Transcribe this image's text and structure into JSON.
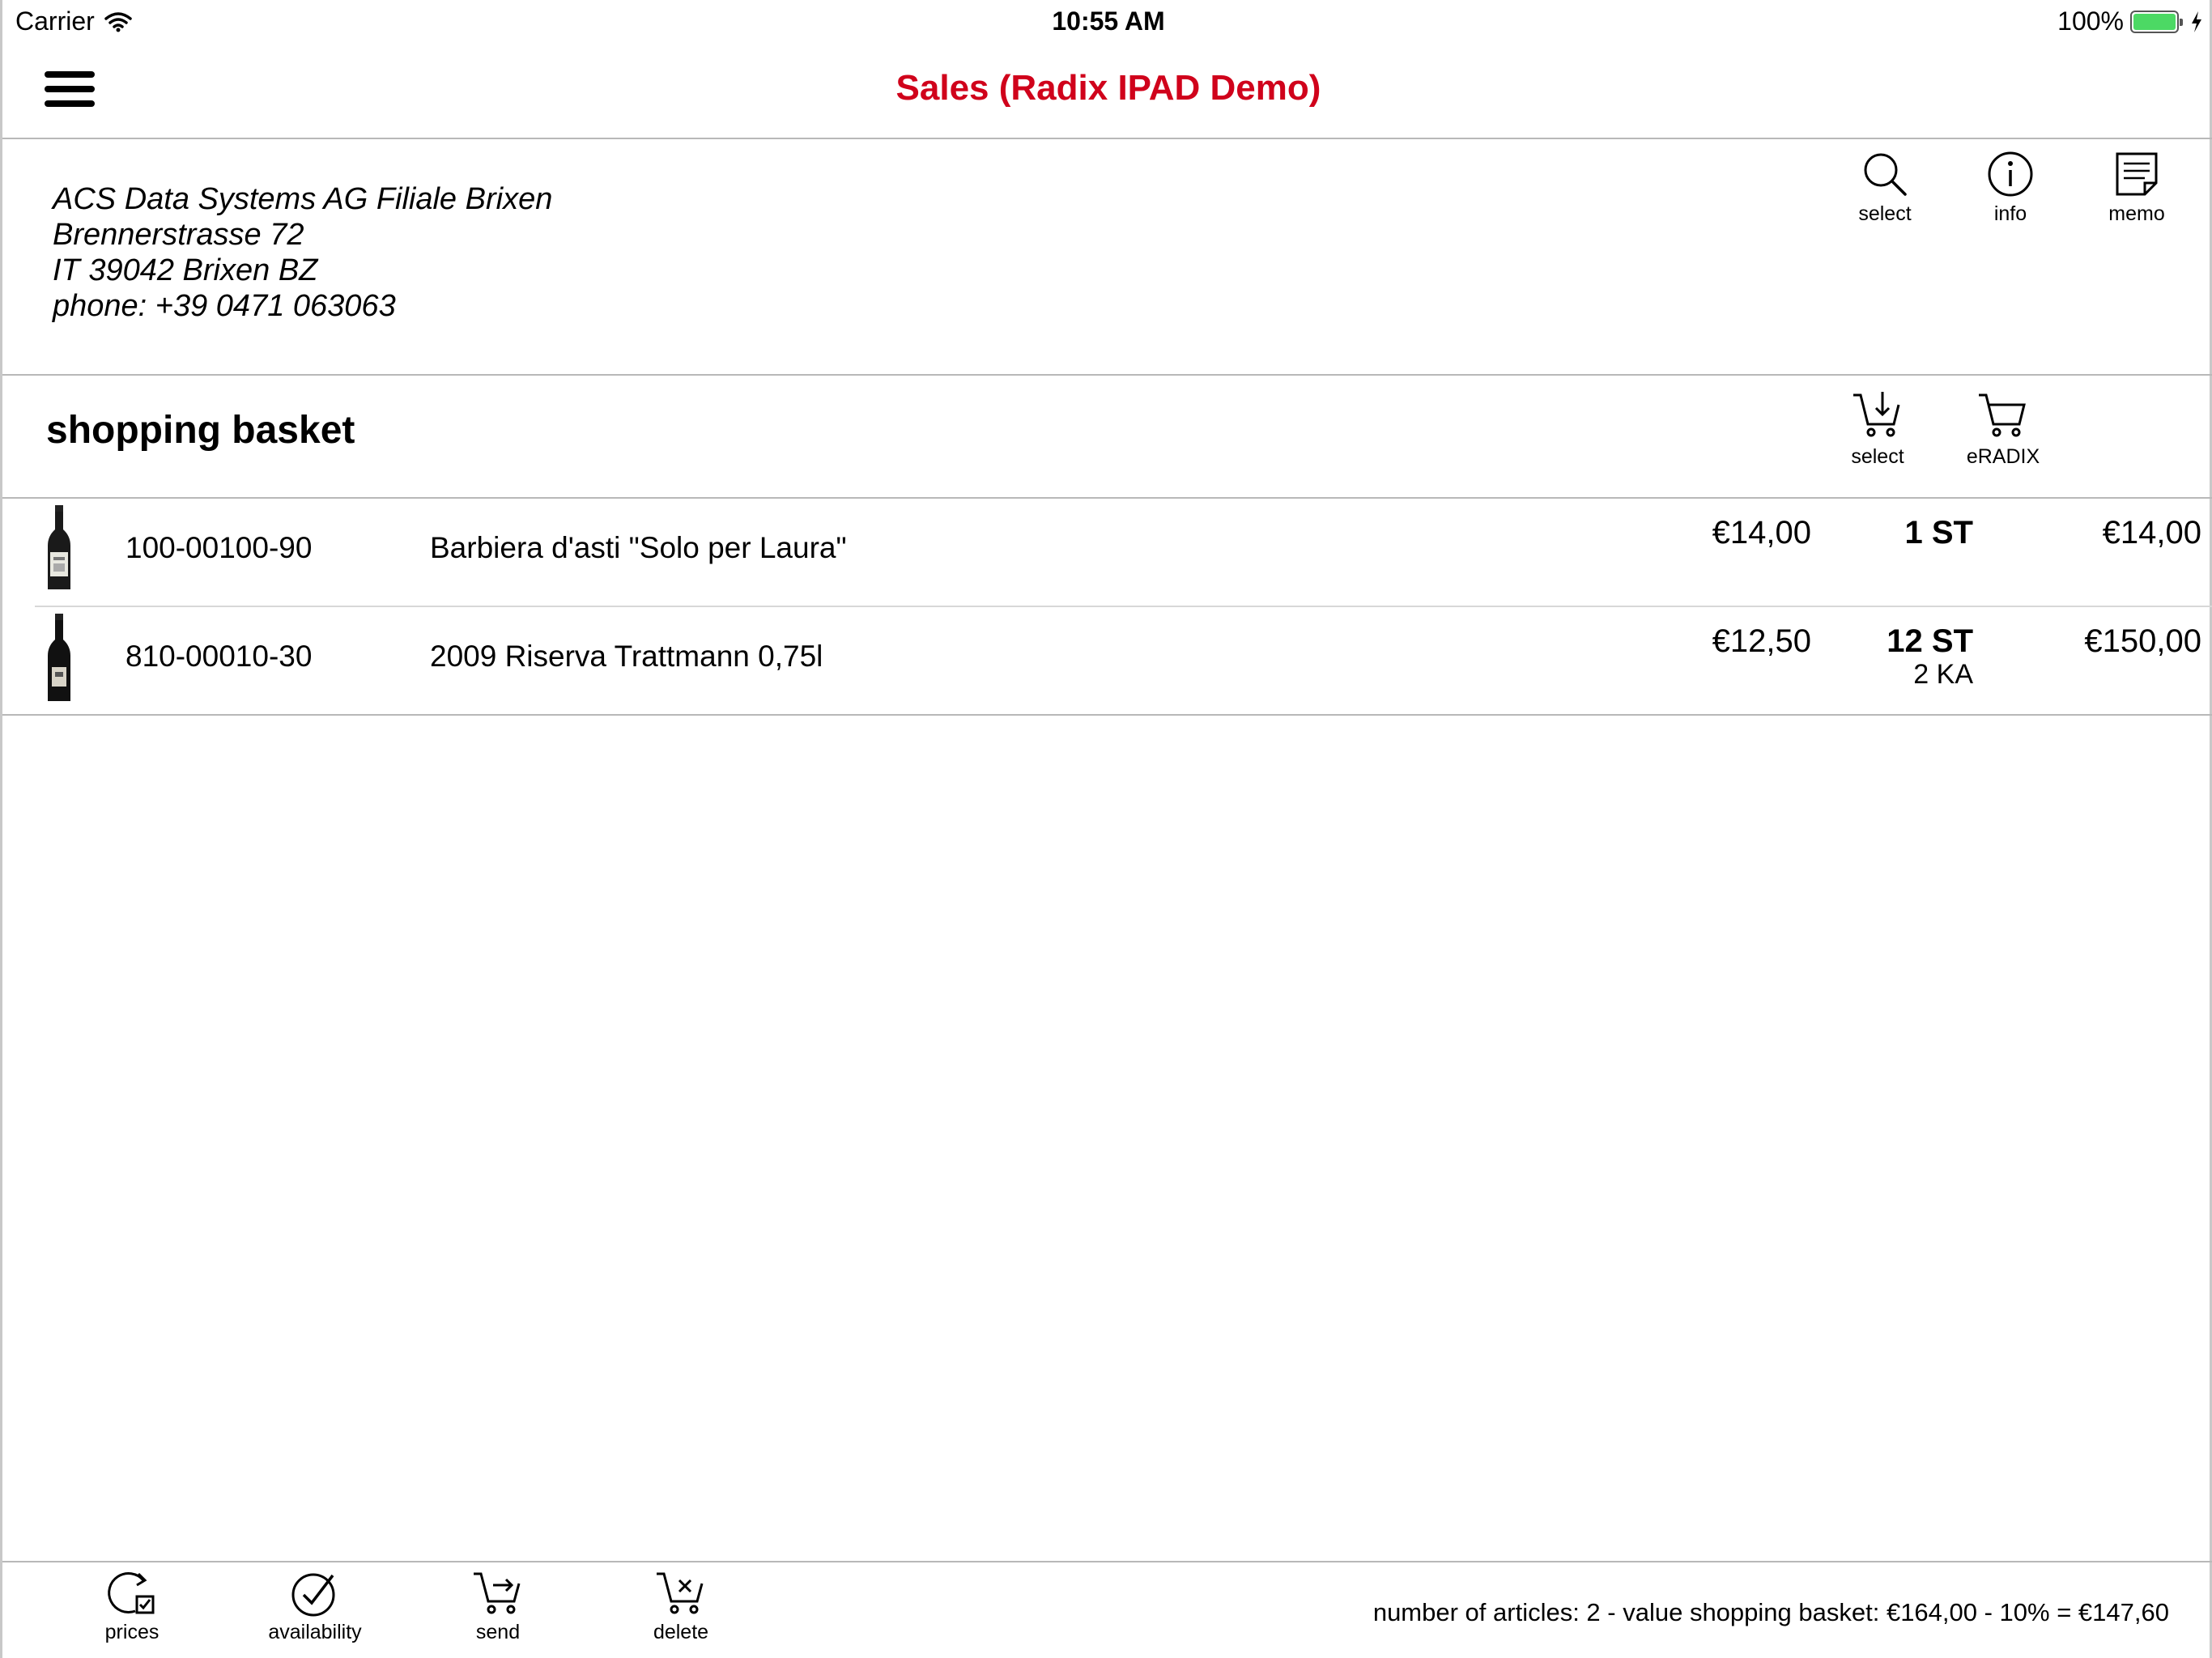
{
  "status": {
    "carrier": "Carrier",
    "time": "10:55 AM",
    "battery": "100%",
    "battery_level": 1.0
  },
  "nav": {
    "title": "Sales (Radix IPAD Demo)"
  },
  "customer": {
    "name": "ACS Data Systems AG Filiale Brixen",
    "street": "Brennerstrasse 72",
    "city": "IT  39042 Brixen BZ",
    "phone": "phone: +39 0471 063063",
    "actions": {
      "select": "select",
      "info": "info",
      "memo": "memo"
    }
  },
  "basket": {
    "title": "shopping basket",
    "actions": {
      "select": "select",
      "eradix": "eRADIX"
    },
    "items": [
      {
        "code": "100-00100-90",
        "description": "Barbiera d'asti \"Solo per Laura\"",
        "unit_price": "€14,00",
        "quantity": "1 ST",
        "pack": "",
        "total": "€14,00"
      },
      {
        "code": "810-00010-30",
        "description": "2009  Riserva Trattmann 0,75l",
        "unit_price": "€12,50",
        "quantity": "12 ST",
        "pack": "2 KA",
        "total": "€150,00"
      }
    ]
  },
  "toolbar": {
    "prices": "prices",
    "availability": "availability",
    "send": "send",
    "delete": "delete",
    "summary": "number of articles: 2 - value shopping basket: €164,00 - 10%  = €147,60"
  },
  "colors": {
    "title": "#d0021b",
    "battery": "#4cd964",
    "divider": "#b8b8b8"
  }
}
